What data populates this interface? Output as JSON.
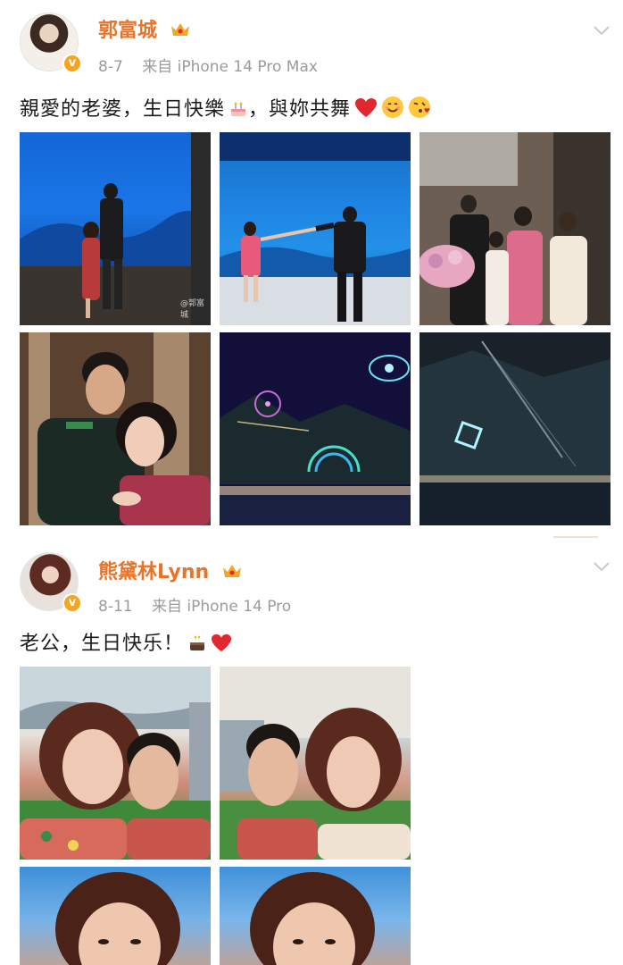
{
  "posts": [
    {
      "user": {
        "name": "郭富城",
        "verified_badge": "v"
      },
      "meta": {
        "date": "8-7",
        "source": "来自 iPhone 14 Pro Max"
      },
      "text": "親愛的老婆，生日快樂",
      "text_suffix": "，與妳共舞",
      "photos": [
        {
          "name": "aquarium-couple-photo",
          "watermark": "@郭富城"
        },
        {
          "name": "aquarium-dance-photo"
        },
        {
          "name": "family-celebration-photo"
        },
        {
          "name": "couple-selfie-photo"
        },
        {
          "name": "ferris-wheel-night-photo"
        },
        {
          "name": "light-show-night-photo"
        }
      ]
    },
    {
      "user": {
        "name": "熊黛林Lynn",
        "verified_badge": "v"
      },
      "meta": {
        "date": "8-11",
        "source": "来自 iPhone 14 Pro"
      },
      "text": "老公，生日快乐！",
      "photos": [
        {
          "name": "couple-selfie-garden-1"
        },
        {
          "name": "couple-selfie-garden-2"
        },
        {
          "name": "woman-portrait-1"
        },
        {
          "name": "woman-portrait-2"
        }
      ]
    }
  ],
  "colors": {
    "username": "#e8742c",
    "meta": "#9b9b9b",
    "badge": "#f4a522",
    "heart": "#e0282e"
  },
  "icons": [
    "crown-icon",
    "verified-badge-icon",
    "chevron-down-icon",
    "cake-emoji",
    "heart-emoji",
    "smile-emoji",
    "kiss-emoji"
  ]
}
